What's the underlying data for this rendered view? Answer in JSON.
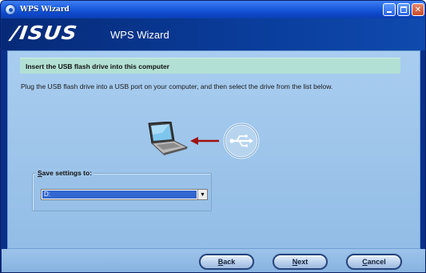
{
  "window": {
    "title": "WPS Wizard",
    "min_glyph": "",
    "max_glyph": "",
    "close_glyph": "✕"
  },
  "header": {
    "logo_text": "/ISUS",
    "app_title": "WPS Wizard"
  },
  "main": {
    "section_title": "Insert the USB flash drive into this computer",
    "instructions": "Plug the USB flash drive into a USB port on your computer, and then select the drive from the list below.",
    "save_settings": {
      "label_accel": "S",
      "label_rest": "ave settings to:",
      "selected_value": "D:",
      "dropdown_glyph": "▼"
    }
  },
  "buttons": {
    "back": {
      "accel": "B",
      "rest": "ack"
    },
    "next": {
      "accel": "N",
      "rest": "ext"
    },
    "cancel": {
      "accel": "C",
      "rest": "ancel"
    }
  },
  "colors": {
    "accent": "#0a3d9c",
    "panel": "#9ec5ea",
    "header_strip": "#b3e0d4",
    "arrow": "#a01212",
    "selection": "#3267d0"
  },
  "icons": {
    "title": "wizard-globe-icon",
    "laptop": "laptop-icon",
    "arrow": "arrow-left-icon",
    "usb": "usb-icon"
  }
}
